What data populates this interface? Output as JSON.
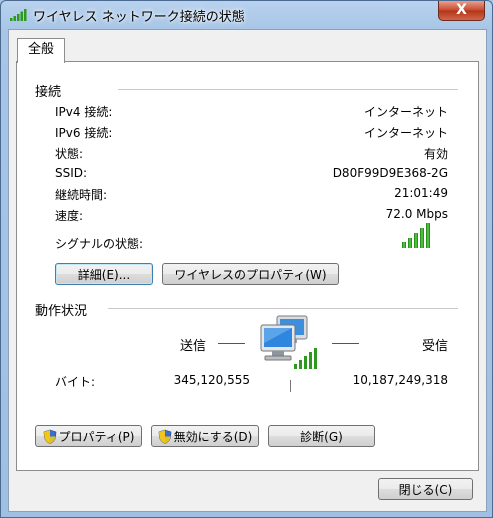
{
  "window": {
    "title": "ワイヤレス ネットワーク接続の状態",
    "close_label": "X"
  },
  "tabs": [
    {
      "label": "全般"
    }
  ],
  "connection": {
    "heading": "接続",
    "rows": [
      {
        "label": "IPv4 接続:",
        "value": "インターネット"
      },
      {
        "label": "IPv6 接続:",
        "value": "インターネット"
      },
      {
        "label": "状態:",
        "value": "有効"
      },
      {
        "label": "SSID:",
        "value": "D80F99D9E368-2G"
      },
      {
        "label": "継続時間:",
        "value": "21:01:49"
      },
      {
        "label": "速度:",
        "value": "72.0 Mbps"
      }
    ],
    "signal_label": "シグナルの状態:",
    "signal_bars": 5,
    "details_button": "詳細(E)...",
    "wireless_props_button": "ワイヤレスのプロパティ(W)"
  },
  "activity": {
    "heading": "動作状況",
    "sent_label": "送信",
    "received_label": "受信",
    "bytes_label": "バイト:",
    "bytes_sent": "345,120,555",
    "bytes_received": "10,187,249,318"
  },
  "actions": {
    "properties_button": "プロパティ(P)",
    "disable_button": "無効にする(D)",
    "diagnose_button": "診断(G)"
  },
  "footer": {
    "close_button": "閉じる(C)"
  },
  "icons": {
    "signal": "signal-bars-icon",
    "shield": "uac-shield-icon",
    "network": "network-computers-icon"
  },
  "colors": {
    "signal_green": "#2d9a1f",
    "titlebar": "#a8c5e6",
    "close_red": "#c7462c"
  }
}
